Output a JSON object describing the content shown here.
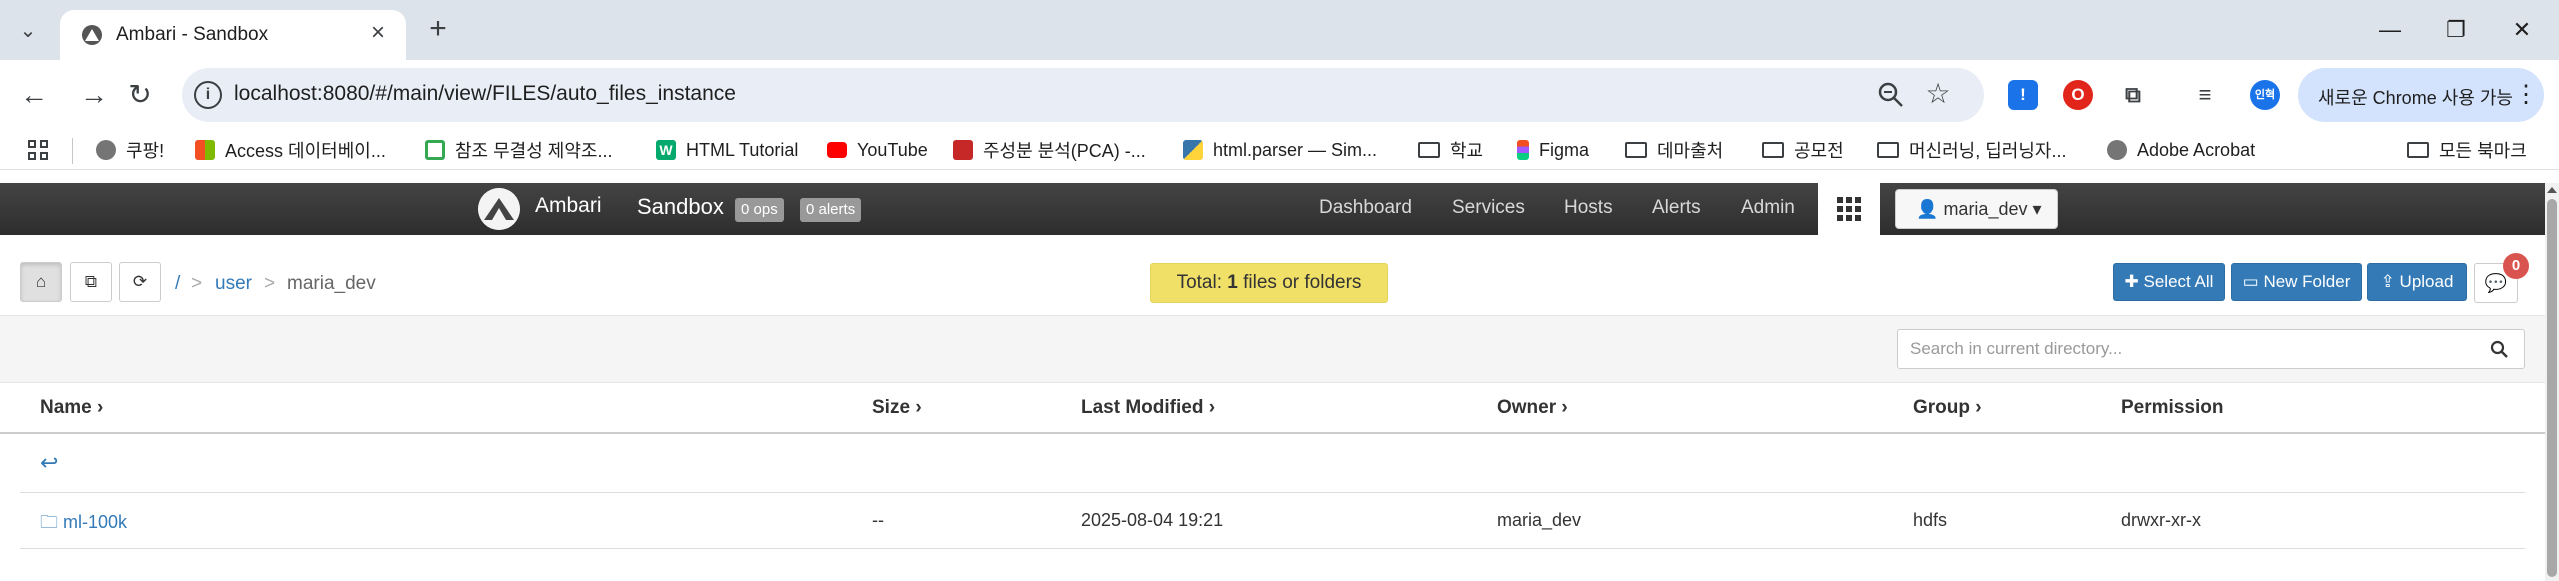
{
  "browser": {
    "tab_title": "Ambari - Sandbox",
    "url": "localhost:8080/#/main/view/FILES/auto_files_instance",
    "update_button": "새로운 Chrome 사용 가능",
    "profile_initial": "인혁",
    "bookmarks": [
      {
        "label": "쿠팡!",
        "icon": "globe-icon"
      },
      {
        "label": "Access 데이터베이...",
        "icon": "microsoft-icon"
      },
      {
        "label": "참조 무결성 제약조...",
        "icon": "page-icon"
      },
      {
        "label": "HTML Tutorial",
        "icon": "w3schools-icon"
      },
      {
        "label": "YouTube",
        "icon": "youtube-icon"
      },
      {
        "label": "주성분 분석(PCA) -...",
        "icon": "site-icon"
      },
      {
        "label": "html.parser — Sim...",
        "icon": "python-icon"
      },
      {
        "label": "학교",
        "icon": "folder-icon"
      },
      {
        "label": "Figma",
        "icon": "figma-icon"
      },
      {
        "label": "데마출처",
        "icon": "folder-icon"
      },
      {
        "label": "공모전",
        "icon": "folder-icon"
      },
      {
        "label": "머신러닝, 딥러닝자...",
        "icon": "folder-icon"
      },
      {
        "label": "Adobe Acrobat",
        "icon": "globe-icon"
      },
      {
        "label": "모든 북마크",
        "icon": "folder-icon"
      }
    ]
  },
  "ambari": {
    "brand": "Ambari",
    "cluster": "Sandbox",
    "ops_badge": "0 ops",
    "alerts_badge": "0 alerts",
    "nav": [
      "Dashboard",
      "Services",
      "Hosts",
      "Alerts",
      "Admin"
    ],
    "user": "maria_dev"
  },
  "files_view": {
    "breadcrumb": {
      "root": "/",
      "sep": ">",
      "parent": "user",
      "current": "maria_dev"
    },
    "total": {
      "prefix": "Total: ",
      "count": "1",
      "suffix": " files or folders"
    },
    "buttons": {
      "select_all": "Select All",
      "new_folder": "New Folder",
      "upload": "Upload"
    },
    "messages_count": "0",
    "search_placeholder": "Search in current directory...",
    "columns": [
      "Name",
      "Size",
      "Last Modified",
      "Owner",
      "Group",
      "Permission"
    ],
    "rows": [
      {
        "name": "ml-100k",
        "size": "--",
        "modified": "2025-08-04 19:21",
        "owner": "maria_dev",
        "group": "hdfs",
        "permission": "drwxr-xr-x"
      }
    ]
  },
  "colors": {
    "link": "#337ab7",
    "primary_button": "#337ab7",
    "total_banner": "#f0e068",
    "header_bg": "#333333",
    "badge_red": "#d9534f"
  }
}
